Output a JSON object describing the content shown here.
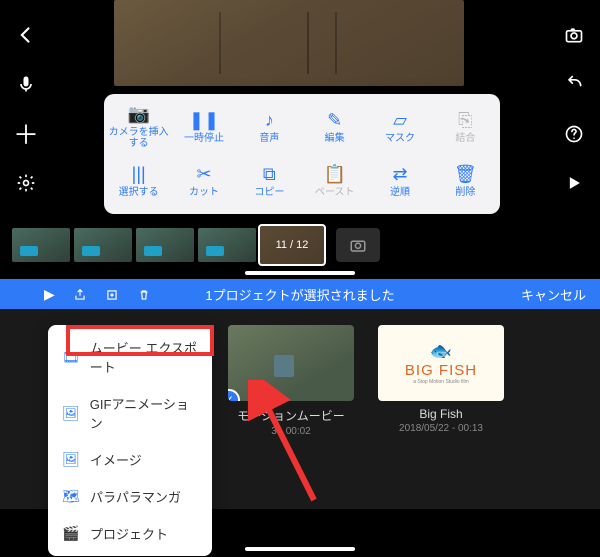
{
  "top": {
    "frame_counter": "11 / 12",
    "toolbar": [
      {
        "id": "insert-camera",
        "label": "カメラを挿入\nする",
        "icon": "📷",
        "enabled": true
      },
      {
        "id": "pause",
        "label": "一時停止",
        "icon": "❚❚",
        "enabled": true
      },
      {
        "id": "audio",
        "label": "音声",
        "icon": "♪",
        "enabled": true
      },
      {
        "id": "edit",
        "label": "編集",
        "icon": "✎",
        "enabled": true
      },
      {
        "id": "mask",
        "label": "マスク",
        "icon": "▱",
        "enabled": true
      },
      {
        "id": "merge",
        "label": "結合",
        "icon": "⎘",
        "enabled": false
      },
      {
        "id": "select",
        "label": "選択する",
        "icon": "|||",
        "enabled": true
      },
      {
        "id": "cut",
        "label": "カット",
        "icon": "✂",
        "enabled": true
      },
      {
        "id": "copy",
        "label": "コピー",
        "icon": "⧉",
        "enabled": true
      },
      {
        "id": "paste",
        "label": "ペースト",
        "icon": "📋",
        "enabled": false
      },
      {
        "id": "reverse",
        "label": "逆順",
        "icon": "⇄",
        "enabled": true
      },
      {
        "id": "delete",
        "label": "削除",
        "icon": "🗑",
        "enabled": true
      }
    ]
  },
  "bottom": {
    "bar_title": "1プロジェクトが選択されました",
    "cancel": "キャンセル",
    "menu": [
      {
        "id": "movie-export",
        "label": "ムービー エクスポート",
        "icon": "🎞"
      },
      {
        "id": "gif-anim",
        "label": "GIFアニメーション",
        "icon": "🖼"
      },
      {
        "id": "image",
        "label": "イメージ",
        "icon": "🖼"
      },
      {
        "id": "flipbook",
        "label": "パラパラマンガ",
        "icon": "🗺"
      },
      {
        "id": "project",
        "label": "プロジェクト",
        "icon": "🎬"
      }
    ],
    "projects": [
      {
        "id": "p1",
        "title": "モーションムービー",
        "meta": "3 - 00:02",
        "selected": true
      },
      {
        "id": "p2",
        "title": "Big Fish",
        "meta": "2018/05/22 - 00:13",
        "selected": false,
        "logo": "BIG FISH"
      }
    ]
  }
}
